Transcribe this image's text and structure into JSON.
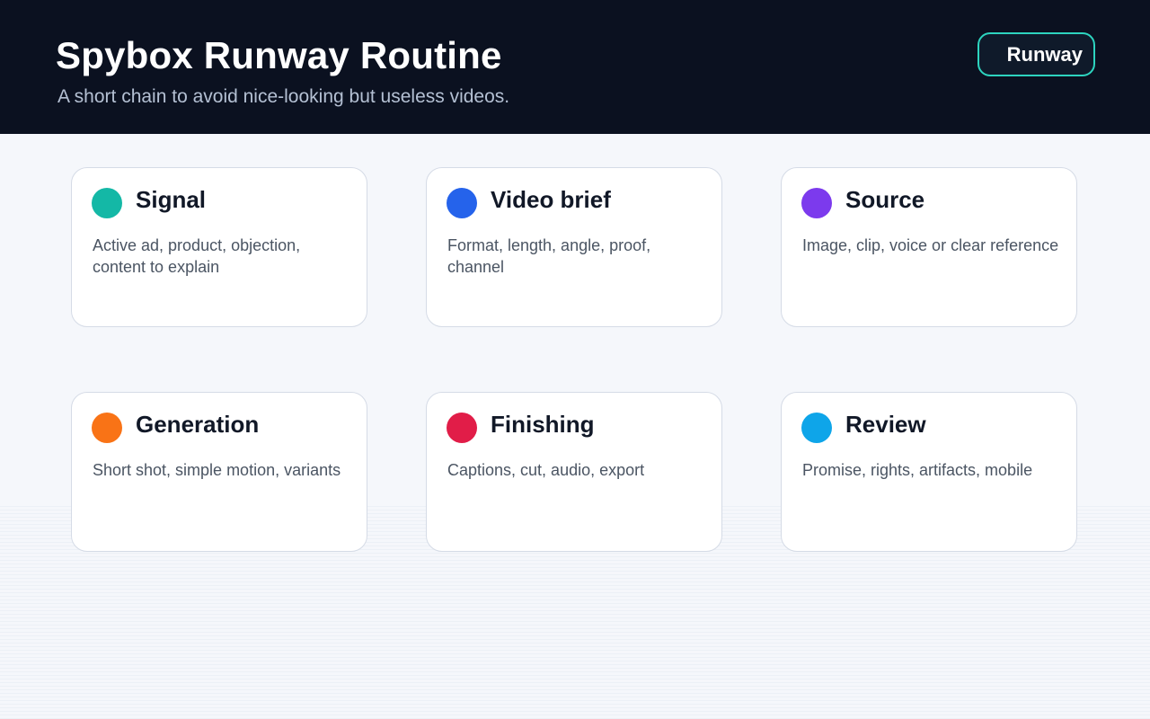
{
  "header": {
    "title": "Spybox Runway Routine",
    "subtitle": "A short chain to avoid nice-looking but useless videos.",
    "badge": "Runway"
  },
  "colors": {
    "header_bg": "#0b1120",
    "badge_border": "#2dd4bf"
  },
  "cards": [
    {
      "title": "Signal",
      "description": "Active ad, product, objection, content to explain",
      "color": "#14b8a6"
    },
    {
      "title": "Video brief",
      "description": "Format, length, angle, proof, channel",
      "color": "#2563eb"
    },
    {
      "title": "Source",
      "description": "Image, clip, voice or clear reference",
      "color": "#7c3aed"
    },
    {
      "title": "Generation",
      "description": "Short shot, simple motion, variants",
      "color": "#f97316"
    },
    {
      "title": "Finishing",
      "description": "Captions, cut, audio, export",
      "color": "#e11d48"
    },
    {
      "title": "Review",
      "description": "Promise, rights, artifacts, mobile",
      "color": "#0ea5e9"
    }
  ]
}
